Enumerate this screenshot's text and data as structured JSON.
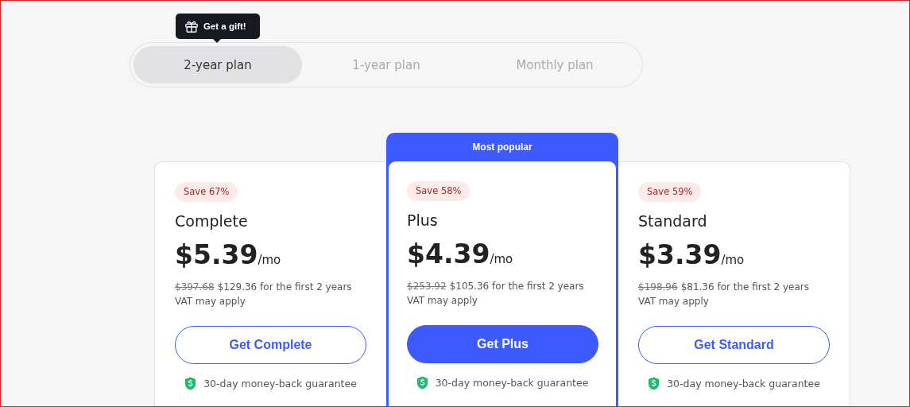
{
  "gift_tooltip": {
    "label": "Get a gift!"
  },
  "billing_tabs": [
    {
      "label": "2-year plan",
      "selected": true
    },
    {
      "label": "1-year plan",
      "selected": false
    },
    {
      "label": "Monthly plan",
      "selected": false
    }
  ],
  "plans": [
    {
      "badge": "Save 67%",
      "name": "Complete",
      "price": "$5.39",
      "unit": "/mo",
      "original_price": "$397.68",
      "total": "$129.36 for the first 2 years",
      "vat": "VAT may apply",
      "button": "Get Complete",
      "popular": false,
      "guarantee": "30-day money-back guarantee"
    },
    {
      "badge": "Save 58%",
      "name": "Plus",
      "price": "$4.39",
      "unit": "/mo",
      "original_price": "$253.92",
      "total": "$105.36 for the first 2 years",
      "vat": "VAT may apply",
      "button": "Get Plus",
      "popular": true,
      "popular_label": "Most popular",
      "guarantee": "30-day money-back guarantee"
    },
    {
      "badge": "Save 59%",
      "name": "Standard",
      "price": "$3.39",
      "unit": "/mo",
      "original_price": "$198.96",
      "total": "$81.36 for the first 2 years",
      "vat": "VAT may apply",
      "button": "Get Standard",
      "popular": false,
      "guarantee": "30-day money-back guarantee"
    }
  ]
}
